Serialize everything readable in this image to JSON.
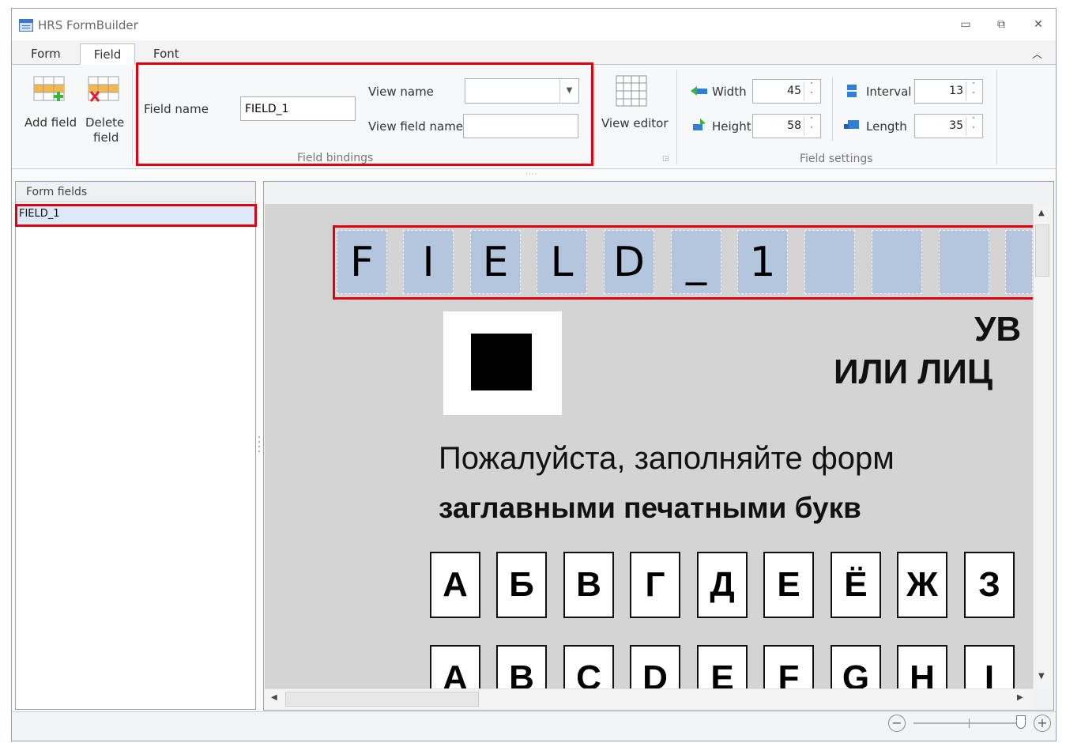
{
  "app": {
    "title": "HRS FormBuilder"
  },
  "window_controls": {
    "minimize": "▭",
    "restore": "⧉",
    "close": "✕"
  },
  "tabs": [
    {
      "label": "Form",
      "active": false
    },
    {
      "label": "Field",
      "active": true
    },
    {
      "label": "Font",
      "active": false
    }
  ],
  "ribbon": {
    "add_field": "Add field",
    "delete_field_line1": "Delete",
    "delete_field_line2": "field",
    "field_name_label": "Field name",
    "field_name_value": "FIELD_1",
    "view_name_label": "View name",
    "view_name_value": "",
    "view_field_name_label": "View field name",
    "view_field_name_value": "",
    "field_bindings_caption": "Field bindings",
    "view_editor": "View editor",
    "width_label": "Width",
    "width_value": "45",
    "height_label": "Height",
    "height_value": "58",
    "interval_label": "Interval",
    "interval_value": "13",
    "length_label": "Length",
    "length_value": "35",
    "field_settings_caption": "Field settings"
  },
  "form_fields": {
    "header": "Form fields",
    "items": [
      "FIELD_1"
    ]
  },
  "field_cells": [
    "F",
    "I",
    "E",
    "L",
    "D",
    "_",
    "1",
    "",
    "",
    "",
    ""
  ],
  "document": {
    "heading_line1": "УВ",
    "heading_line2": "ИЛИ ЛИЦ",
    "instruction_line1": "Пожалуйста, заполняйте форм",
    "instruction_line2": "заглавными печатными букв",
    "cyrillic_letters": [
      "А",
      "Б",
      "В",
      "Г",
      "Д",
      "Е",
      "Ё",
      "Ж",
      "З"
    ],
    "latin_letters": [
      "A",
      "B",
      "C",
      "D",
      "E",
      "F",
      "G",
      "H",
      "I"
    ]
  },
  "colors": {
    "highlight": "#e0000f",
    "field_cell": "#b3c6de",
    "canvas_bg": "#d4d4d4"
  }
}
